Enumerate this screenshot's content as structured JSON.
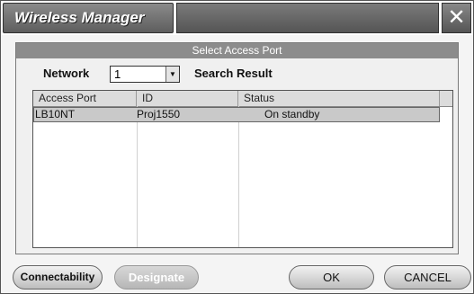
{
  "window": {
    "title": "Wireless Manager",
    "close_glyph": "✕"
  },
  "panel": {
    "header": "Select Access Port",
    "network_label": "Network",
    "network_value": "1",
    "search_result_label": "Search Result"
  },
  "table": {
    "columns": [
      "Access Port",
      "ID",
      "Status"
    ],
    "rows": [
      {
        "access_port": "LB10NT",
        "id": "Proj1550",
        "status": "On standby"
      }
    ]
  },
  "buttons": {
    "connectability": "Connectability",
    "designate": "Designate",
    "ok": "OK",
    "cancel": "CANCEL"
  },
  "icons": {
    "close": "close-icon",
    "dropdown": "chevron-down-icon"
  }
}
